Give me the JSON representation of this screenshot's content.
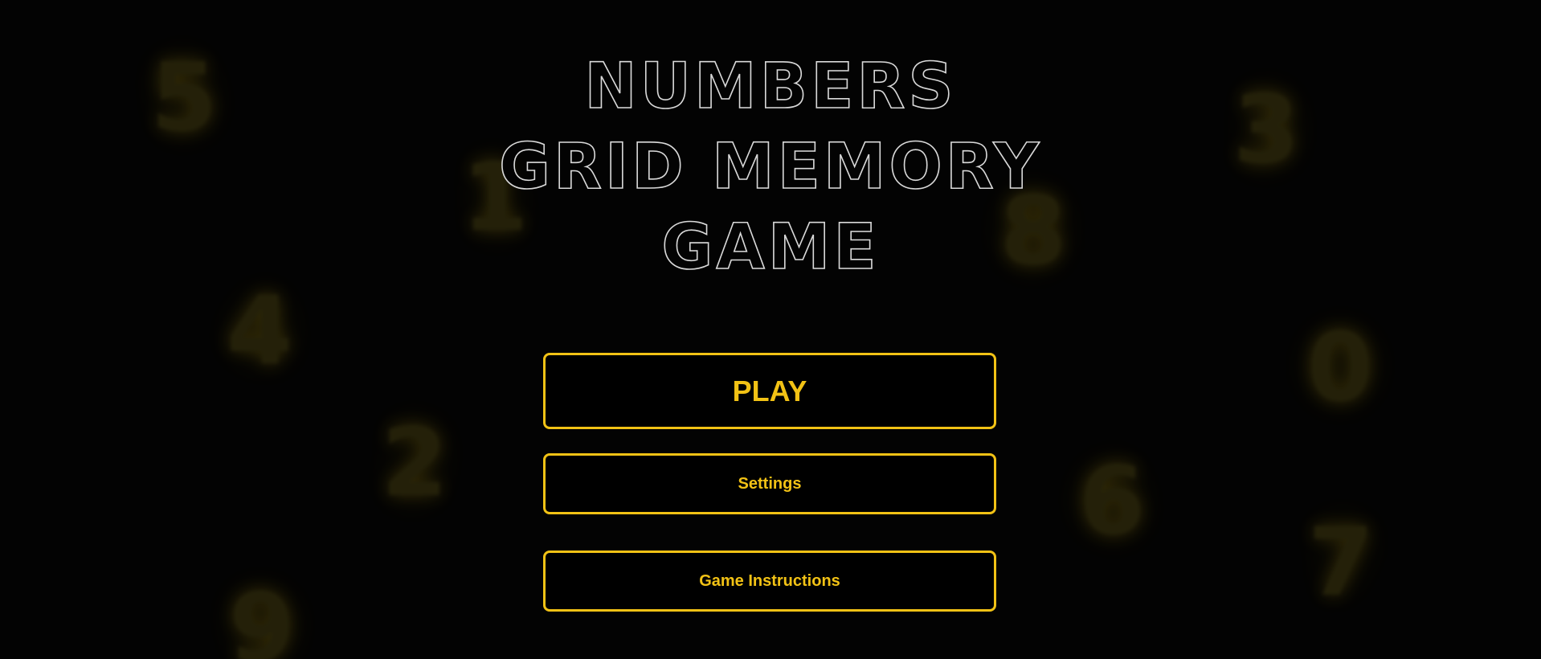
{
  "title": {
    "line1": "NUMBERS",
    "line2": "GRID MEMORY",
    "line3": "GAME"
  },
  "menu": {
    "play_label": "PLAY",
    "settings_label": "Settings",
    "instructions_label": "Game Instructions"
  },
  "background_digits": [
    "5",
    "1",
    "4",
    "2",
    "9",
    "3",
    "8",
    "0",
    "6",
    "7"
  ],
  "colors": {
    "background": "#030303",
    "accent": "#f2c215",
    "title_outline": "#d9d9d9"
  }
}
